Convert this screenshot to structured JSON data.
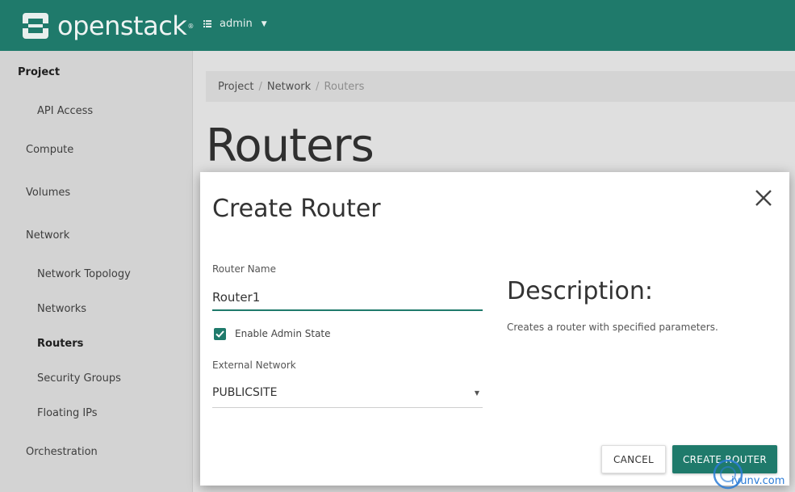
{
  "header": {
    "brand_name": "openstack",
    "brand_reg": "®",
    "project_selector_label": "admin",
    "brand_color": "#1f7a6b"
  },
  "sidebar": {
    "items": [
      {
        "label": "Project",
        "level": 0
      },
      {
        "label": "API Access",
        "level": 2
      },
      {
        "label": "Compute",
        "level": 1
      },
      {
        "label": "Volumes",
        "level": 1
      },
      {
        "label": "Network",
        "level": 1
      },
      {
        "label": "Network Topology",
        "level": 2
      },
      {
        "label": "Networks",
        "level": 2
      },
      {
        "label": "Routers",
        "level": 2,
        "active": true
      },
      {
        "label": "Security Groups",
        "level": 2
      },
      {
        "label": "Floating IPs",
        "level": 2
      },
      {
        "label": "Orchestration",
        "level": 1
      }
    ]
  },
  "breadcrumb": {
    "items": [
      "Project",
      "Network",
      "Routers"
    ]
  },
  "main": {
    "title": "Routers"
  },
  "modal": {
    "title": "Create Router",
    "router_name_label": "Router Name",
    "router_name_value": "Router1",
    "enable_admin_label": "Enable Admin State",
    "enable_admin_checked": true,
    "external_network_label": "External Network",
    "external_network_value": "PUBLICSITE",
    "description_title": "Description:",
    "description_text": "Creates a router with specified parameters.",
    "cancel_label": "CANCEL",
    "submit_label": "CREATE ROUTER"
  },
  "watermark": {
    "text": "iyunv.com"
  },
  "icons": {
    "close": "close-icon",
    "checkbox": "checkmark-icon",
    "select_caret": "caret-down-icon",
    "project_list": "list-icon"
  }
}
